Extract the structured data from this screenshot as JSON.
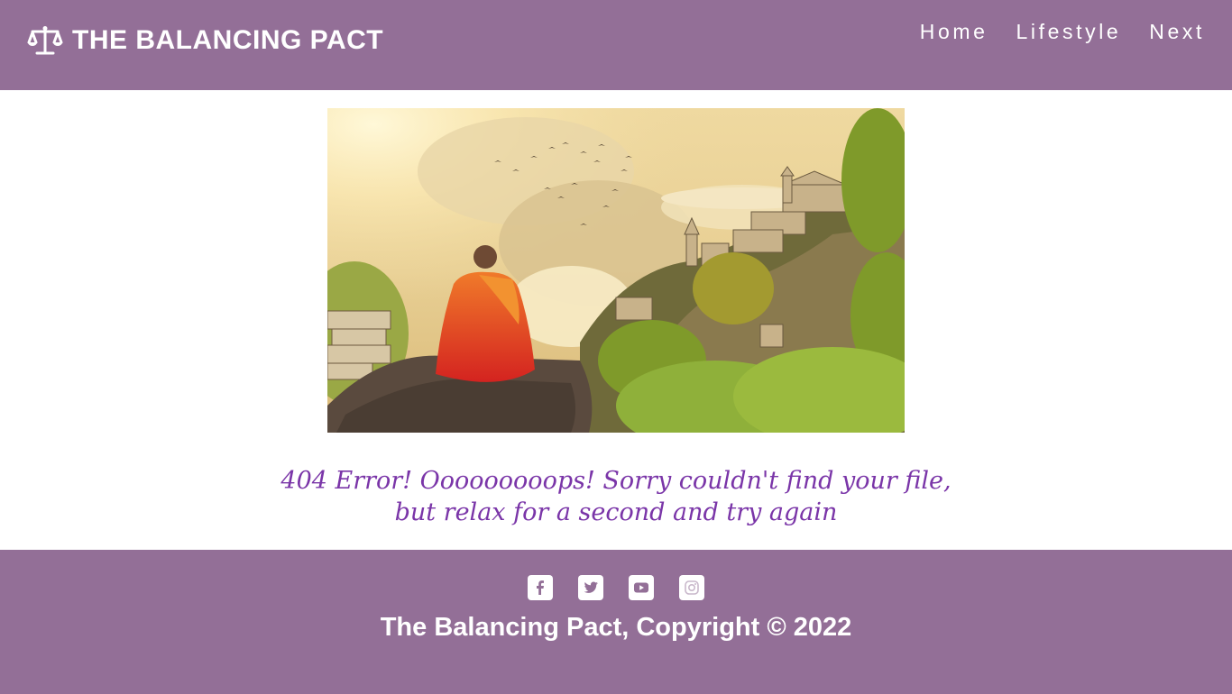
{
  "colors": {
    "header_bg": "#936f97",
    "footer_bg": "#936f97",
    "message_text": "#7a35a8"
  },
  "header": {
    "logo_icon": "balance-scale-icon",
    "title": "THE BALANCING PACT",
    "nav": [
      {
        "label": "Home"
      },
      {
        "label": "Lifestyle"
      },
      {
        "label": "Next"
      }
    ]
  },
  "hero": {
    "image": "meditating-monk-overlooking-castle-landscape"
  },
  "error": {
    "line1": "404 Error! Ooooooooops! Sorry couldn't find your file,",
    "line2": "but relax for a second and try again"
  },
  "footer": {
    "socials": [
      {
        "icon": "facebook-icon"
      },
      {
        "icon": "twitter-icon"
      },
      {
        "icon": "youtube-icon"
      },
      {
        "icon": "instagram-icon"
      }
    ],
    "copyright": "The Balancing Pact, Copyright © 2022"
  }
}
